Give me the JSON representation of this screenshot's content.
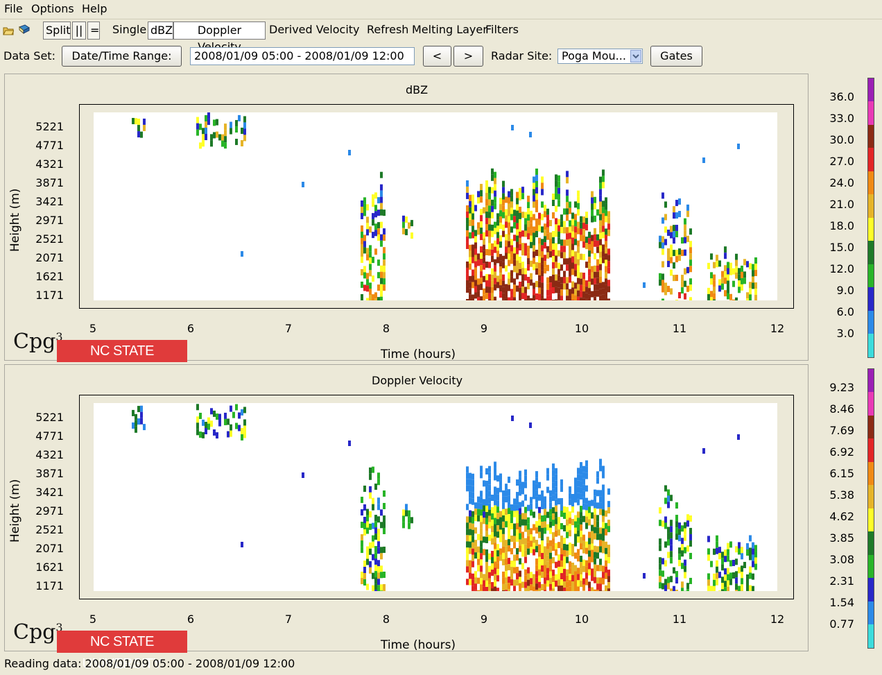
{
  "menu": [
    "File",
    "Options",
    "Help"
  ],
  "toolbar": {
    "split": "Split",
    "pipes": "||",
    "equals": "=",
    "single": "Single",
    "dbz": "dBZ",
    "doppler": "Doppler Velocity",
    "derived": "Derived Velocity",
    "refresh": "Refresh",
    "melting": "Melting Layer",
    "filters": "Filters"
  },
  "dataset": {
    "label": "Data Set:",
    "range_button": "Date/Time Range:",
    "range_value": "2008/01/09 05:00 - 2008/01/09 12:00",
    "prev": "<",
    "next": ">",
    "site_label": "Radar Site:",
    "site_value": "Poga Mou...",
    "gates": "Gates"
  },
  "panels": [
    {
      "title": "dBZ",
      "xlabel": "Time (hours)",
      "ylabel": "Height (m)",
      "colorbar": [
        "36.0",
        "33.0",
        "30.0",
        "27.0",
        "24.0",
        "21.0",
        "18.0",
        "15.0",
        "12.0",
        "9.0",
        "6.0",
        "3.0"
      ]
    },
    {
      "title": "Doppler Velocity",
      "xlabel": "Time (hours)",
      "ylabel": "Height (m)",
      "colorbar": [
        "9.23",
        "8.46",
        "7.69",
        "6.92",
        "6.15",
        "5.38",
        "4.62",
        "3.85",
        "3.08",
        "2.31",
        "1.54",
        "0.77"
      ]
    }
  ],
  "yticks": [
    "5221",
    "4771",
    "4321",
    "3871",
    "3421",
    "2971",
    "2521",
    "2071",
    "1621",
    "1171"
  ],
  "xticks": [
    "5",
    "6",
    "7",
    "8",
    "9",
    "10",
    "11",
    "12"
  ],
  "logo": {
    "cpg": "Cpg",
    "cpg_sup": "3",
    "ncsu": "NC STATE UNIVERSITY"
  },
  "colorbar_colors": [
    "#9b1fb5",
    "#e83ab6",
    "#8b2a14",
    "#e22626",
    "#f08a14",
    "#e6b428",
    "#ffff28",
    "#1e7a28",
    "#28b428",
    "#2828c8",
    "#2c8ae8",
    "#3cdcdc"
  ],
  "status": "Reading data: 2008/01/09 05:00 - 2008/01/09 12:00"
}
